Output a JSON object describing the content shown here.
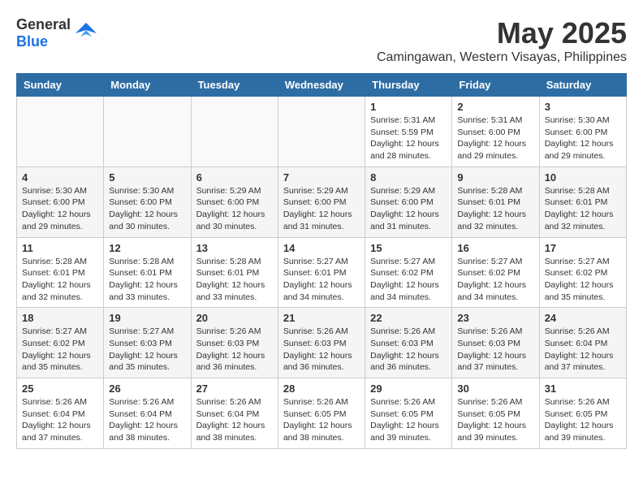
{
  "logo": {
    "general": "General",
    "blue": "Blue"
  },
  "title": "May 2025",
  "location": "Camingawan, Western Visayas, Philippines",
  "days_of_week": [
    "Sunday",
    "Monday",
    "Tuesday",
    "Wednesday",
    "Thursday",
    "Friday",
    "Saturday"
  ],
  "weeks": [
    [
      {
        "day": "",
        "info": ""
      },
      {
        "day": "",
        "info": ""
      },
      {
        "day": "",
        "info": ""
      },
      {
        "day": "",
        "info": ""
      },
      {
        "day": "1",
        "info": "Sunrise: 5:31 AM\nSunset: 5:59 PM\nDaylight: 12 hours and 28 minutes."
      },
      {
        "day": "2",
        "info": "Sunrise: 5:31 AM\nSunset: 6:00 PM\nDaylight: 12 hours and 29 minutes."
      },
      {
        "day": "3",
        "info": "Sunrise: 5:30 AM\nSunset: 6:00 PM\nDaylight: 12 hours and 29 minutes."
      }
    ],
    [
      {
        "day": "4",
        "info": "Sunrise: 5:30 AM\nSunset: 6:00 PM\nDaylight: 12 hours and 29 minutes."
      },
      {
        "day": "5",
        "info": "Sunrise: 5:30 AM\nSunset: 6:00 PM\nDaylight: 12 hours and 30 minutes."
      },
      {
        "day": "6",
        "info": "Sunrise: 5:29 AM\nSunset: 6:00 PM\nDaylight: 12 hours and 30 minutes."
      },
      {
        "day": "7",
        "info": "Sunrise: 5:29 AM\nSunset: 6:00 PM\nDaylight: 12 hours and 31 minutes."
      },
      {
        "day": "8",
        "info": "Sunrise: 5:29 AM\nSunset: 6:00 PM\nDaylight: 12 hours and 31 minutes."
      },
      {
        "day": "9",
        "info": "Sunrise: 5:28 AM\nSunset: 6:01 PM\nDaylight: 12 hours and 32 minutes."
      },
      {
        "day": "10",
        "info": "Sunrise: 5:28 AM\nSunset: 6:01 PM\nDaylight: 12 hours and 32 minutes."
      }
    ],
    [
      {
        "day": "11",
        "info": "Sunrise: 5:28 AM\nSunset: 6:01 PM\nDaylight: 12 hours and 32 minutes."
      },
      {
        "day": "12",
        "info": "Sunrise: 5:28 AM\nSunset: 6:01 PM\nDaylight: 12 hours and 33 minutes."
      },
      {
        "day": "13",
        "info": "Sunrise: 5:28 AM\nSunset: 6:01 PM\nDaylight: 12 hours and 33 minutes."
      },
      {
        "day": "14",
        "info": "Sunrise: 5:27 AM\nSunset: 6:01 PM\nDaylight: 12 hours and 34 minutes."
      },
      {
        "day": "15",
        "info": "Sunrise: 5:27 AM\nSunset: 6:02 PM\nDaylight: 12 hours and 34 minutes."
      },
      {
        "day": "16",
        "info": "Sunrise: 5:27 AM\nSunset: 6:02 PM\nDaylight: 12 hours and 34 minutes."
      },
      {
        "day": "17",
        "info": "Sunrise: 5:27 AM\nSunset: 6:02 PM\nDaylight: 12 hours and 35 minutes."
      }
    ],
    [
      {
        "day": "18",
        "info": "Sunrise: 5:27 AM\nSunset: 6:02 PM\nDaylight: 12 hours and 35 minutes."
      },
      {
        "day": "19",
        "info": "Sunrise: 5:27 AM\nSunset: 6:03 PM\nDaylight: 12 hours and 35 minutes."
      },
      {
        "day": "20",
        "info": "Sunrise: 5:26 AM\nSunset: 6:03 PM\nDaylight: 12 hours and 36 minutes."
      },
      {
        "day": "21",
        "info": "Sunrise: 5:26 AM\nSunset: 6:03 PM\nDaylight: 12 hours and 36 minutes."
      },
      {
        "day": "22",
        "info": "Sunrise: 5:26 AM\nSunset: 6:03 PM\nDaylight: 12 hours and 36 minutes."
      },
      {
        "day": "23",
        "info": "Sunrise: 5:26 AM\nSunset: 6:03 PM\nDaylight: 12 hours and 37 minutes."
      },
      {
        "day": "24",
        "info": "Sunrise: 5:26 AM\nSunset: 6:04 PM\nDaylight: 12 hours and 37 minutes."
      }
    ],
    [
      {
        "day": "25",
        "info": "Sunrise: 5:26 AM\nSunset: 6:04 PM\nDaylight: 12 hours and 37 minutes."
      },
      {
        "day": "26",
        "info": "Sunrise: 5:26 AM\nSunset: 6:04 PM\nDaylight: 12 hours and 38 minutes."
      },
      {
        "day": "27",
        "info": "Sunrise: 5:26 AM\nSunset: 6:04 PM\nDaylight: 12 hours and 38 minutes."
      },
      {
        "day": "28",
        "info": "Sunrise: 5:26 AM\nSunset: 6:05 PM\nDaylight: 12 hours and 38 minutes."
      },
      {
        "day": "29",
        "info": "Sunrise: 5:26 AM\nSunset: 6:05 PM\nDaylight: 12 hours and 39 minutes."
      },
      {
        "day": "30",
        "info": "Sunrise: 5:26 AM\nSunset: 6:05 PM\nDaylight: 12 hours and 39 minutes."
      },
      {
        "day": "31",
        "info": "Sunrise: 5:26 AM\nSunset: 6:05 PM\nDaylight: 12 hours and 39 minutes."
      }
    ]
  ]
}
